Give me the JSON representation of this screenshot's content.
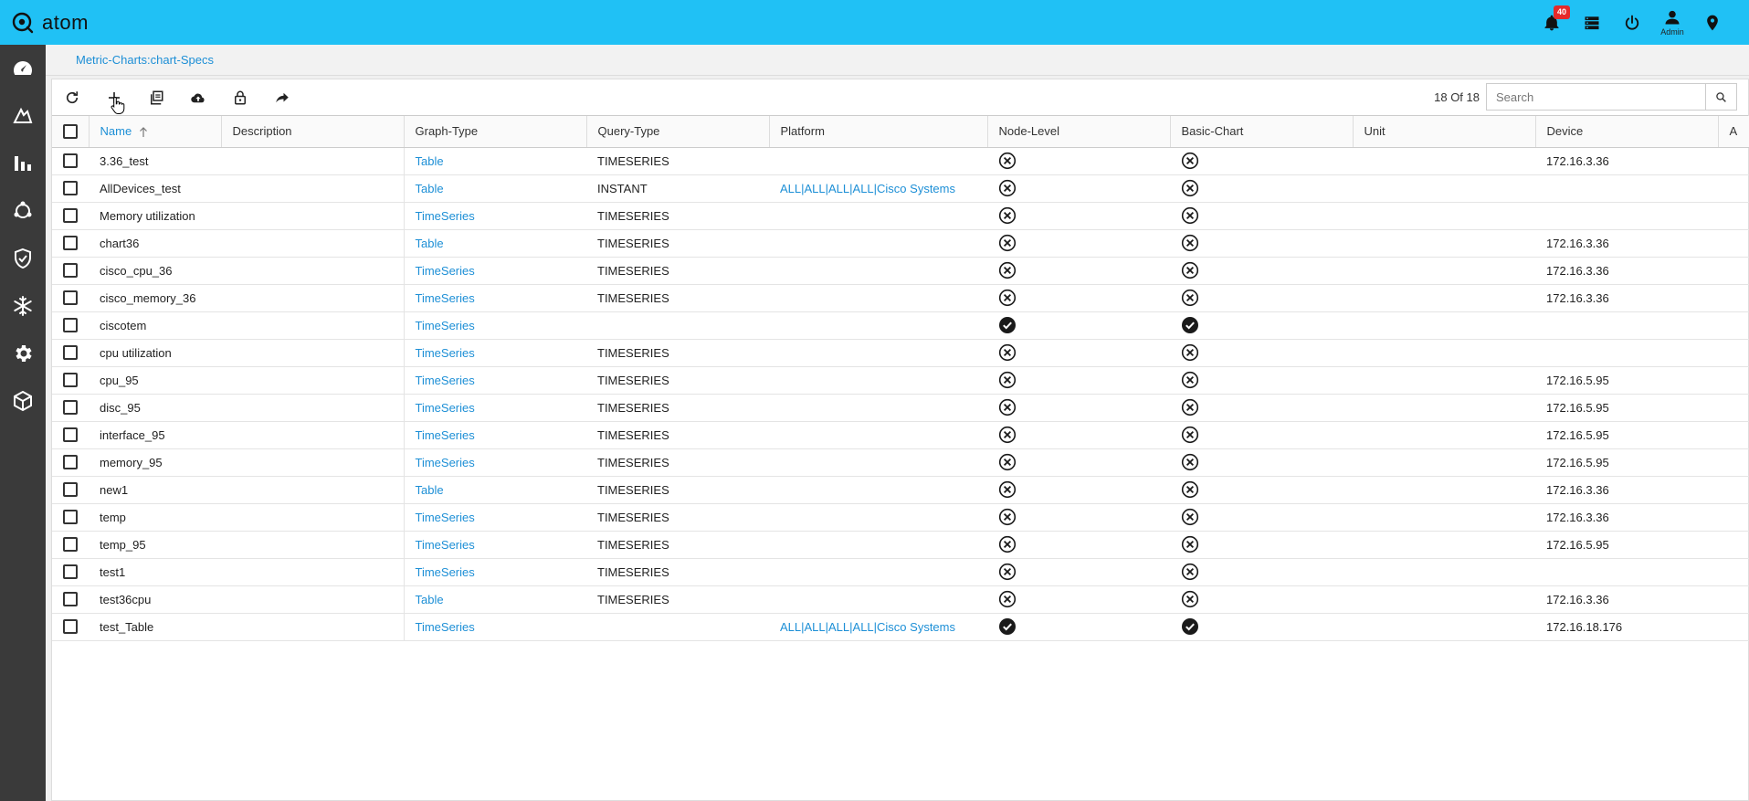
{
  "app": {
    "name": "atom"
  },
  "header": {
    "notifications_count": "40",
    "admin_label": "Admin",
    "icons": [
      "bell-icon",
      "server-icon",
      "power-icon",
      "user-icon",
      "location-pin-icon"
    ]
  },
  "sidebar": {
    "items": [
      {
        "name": "dashboard-icon"
      },
      {
        "name": "chart-transform-icon"
      },
      {
        "name": "bar-chart-icon"
      },
      {
        "name": "network-nodes-icon"
      },
      {
        "name": "shield-check-icon"
      },
      {
        "name": "snowflake-icon"
      },
      {
        "name": "gear-icon"
      },
      {
        "name": "cube-network-icon"
      }
    ]
  },
  "breadcrumb": "Metric-Charts:chart-Specs",
  "toolbar": {
    "icons": [
      "refresh-icon",
      "add-icon",
      "copy-icon",
      "cloud-upload-icon",
      "lock-icon",
      "share-icon"
    ],
    "count_text": "18 Of 18",
    "search_placeholder": "Search"
  },
  "table": {
    "columns": [
      "Name",
      "Description",
      "Graph-Type",
      "Query-Type",
      "Platform",
      "Node-Level",
      "Basic-Chart",
      "Unit",
      "Device",
      "A"
    ],
    "rows": [
      {
        "name": "3.36_test",
        "description": "",
        "graph_type": "Table",
        "query_type": "TIMESERIES",
        "platform": "",
        "node_level": false,
        "basic_chart": false,
        "unit": "",
        "device": "172.16.3.36"
      },
      {
        "name": "AllDevices_test",
        "description": "",
        "graph_type": "Table",
        "query_type": "INSTANT",
        "platform": "ALL|ALL|ALL|ALL|Cisco Systems",
        "node_level": false,
        "basic_chart": false,
        "unit": "",
        "device": ""
      },
      {
        "name": "Memory utilization",
        "description": "",
        "graph_type": "TimeSeries",
        "query_type": "TIMESERIES",
        "platform": "",
        "node_level": false,
        "basic_chart": false,
        "unit": "",
        "device": ""
      },
      {
        "name": "chart36",
        "description": "",
        "graph_type": "Table",
        "query_type": "TIMESERIES",
        "platform": "",
        "node_level": false,
        "basic_chart": false,
        "unit": "",
        "device": "172.16.3.36"
      },
      {
        "name": "cisco_cpu_36",
        "description": "",
        "graph_type": "TimeSeries",
        "query_type": "TIMESERIES",
        "platform": "",
        "node_level": false,
        "basic_chart": false,
        "unit": "",
        "device": "172.16.3.36"
      },
      {
        "name": "cisco_memory_36",
        "description": "",
        "graph_type": "TimeSeries",
        "query_type": "TIMESERIES",
        "platform": "",
        "node_level": false,
        "basic_chart": false,
        "unit": "",
        "device": "172.16.3.36"
      },
      {
        "name": "ciscotem",
        "description": "",
        "graph_type": "TimeSeries",
        "query_type": "",
        "platform": "",
        "node_level": true,
        "basic_chart": true,
        "unit": "",
        "device": ""
      },
      {
        "name": "cpu utilization",
        "description": "",
        "graph_type": "TimeSeries",
        "query_type": "TIMESERIES",
        "platform": "",
        "node_level": false,
        "basic_chart": false,
        "unit": "",
        "device": ""
      },
      {
        "name": "cpu_95",
        "description": "",
        "graph_type": "TimeSeries",
        "query_type": "TIMESERIES",
        "platform": "",
        "node_level": false,
        "basic_chart": false,
        "unit": "",
        "device": "172.16.5.95"
      },
      {
        "name": "disc_95",
        "description": "",
        "graph_type": "TimeSeries",
        "query_type": "TIMESERIES",
        "platform": "",
        "node_level": false,
        "basic_chart": false,
        "unit": "",
        "device": "172.16.5.95"
      },
      {
        "name": "interface_95",
        "description": "",
        "graph_type": "TimeSeries",
        "query_type": "TIMESERIES",
        "platform": "",
        "node_level": false,
        "basic_chart": false,
        "unit": "",
        "device": "172.16.5.95"
      },
      {
        "name": "memory_95",
        "description": "",
        "graph_type": "TimeSeries",
        "query_type": "TIMESERIES",
        "platform": "",
        "node_level": false,
        "basic_chart": false,
        "unit": "",
        "device": "172.16.5.95"
      },
      {
        "name": "new1",
        "description": "",
        "graph_type": "Table",
        "query_type": "TIMESERIES",
        "platform": "",
        "node_level": false,
        "basic_chart": false,
        "unit": "",
        "device": "172.16.3.36"
      },
      {
        "name": "temp",
        "description": "",
        "graph_type": "TimeSeries",
        "query_type": "TIMESERIES",
        "platform": "",
        "node_level": false,
        "basic_chart": false,
        "unit": "",
        "device": "172.16.3.36"
      },
      {
        "name": "temp_95",
        "description": "",
        "graph_type": "TimeSeries",
        "query_type": "TIMESERIES",
        "platform": "",
        "node_level": false,
        "basic_chart": false,
        "unit": "",
        "device": "172.16.5.95"
      },
      {
        "name": "test1",
        "description": "",
        "graph_type": "TimeSeries",
        "query_type": "TIMESERIES",
        "platform": "",
        "node_level": false,
        "basic_chart": false,
        "unit": "",
        "device": ""
      },
      {
        "name": "test36cpu",
        "description": "",
        "graph_type": "Table",
        "query_type": "TIMESERIES",
        "platform": "",
        "node_level": false,
        "basic_chart": false,
        "unit": "",
        "device": "172.16.3.36"
      },
      {
        "name": "test_Table",
        "description": "",
        "graph_type": "TimeSeries",
        "query_type": "",
        "platform": "ALL|ALL|ALL|ALL|Cisco Systems",
        "node_level": true,
        "basic_chart": true,
        "unit": "",
        "device": "172.16.18.176"
      }
    ]
  },
  "colors": {
    "topbar": "#20c1f5",
    "sidebar": "#3a3a3a",
    "link": "#1d8fd6",
    "badge": "#e52a2a"
  }
}
